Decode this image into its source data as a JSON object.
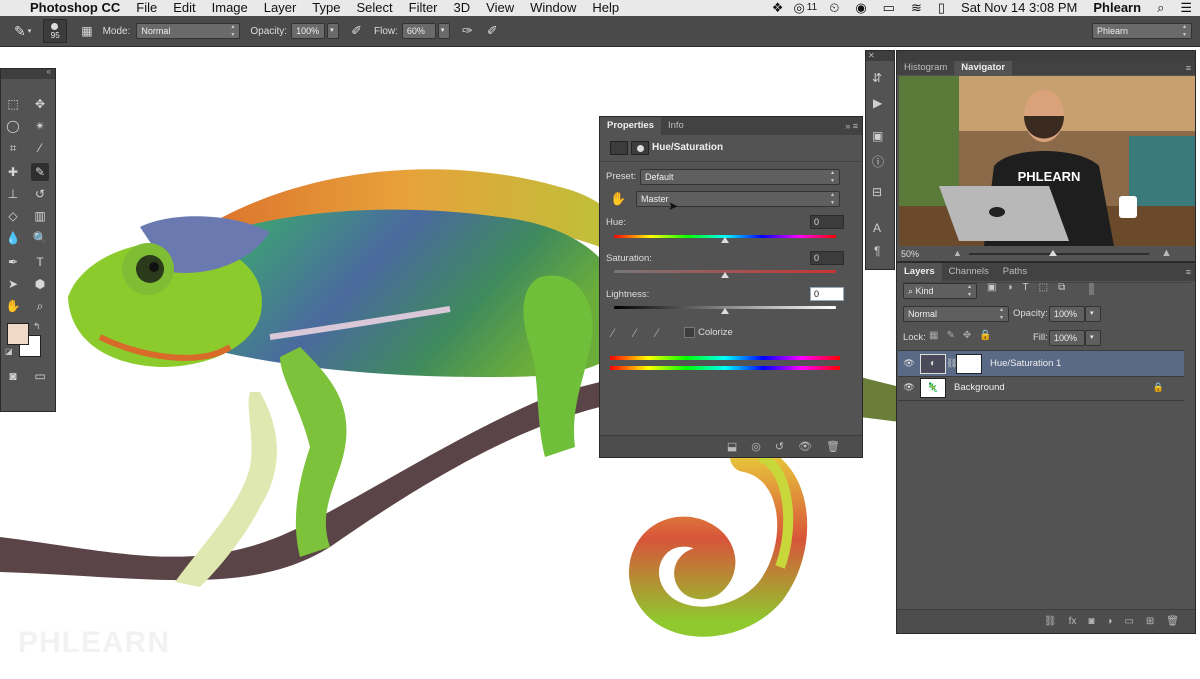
{
  "menubar": {
    "app_name": "Photoshop CC",
    "items": [
      "File",
      "Edit",
      "Image",
      "Layer",
      "Type",
      "Select",
      "Filter",
      "3D",
      "View",
      "Window",
      "Help"
    ],
    "status_number": "11",
    "datetime": "Sat Nov 14  3:08 PM",
    "user": "Phlearn"
  },
  "options": {
    "brush_size": "95",
    "mode_label": "Mode:",
    "mode_value": "Normal",
    "opacity_label": "Opacity:",
    "opacity_value": "100%",
    "flow_label": "Flow:",
    "flow_value": "60%",
    "workspace": "Phlearn"
  },
  "properties": {
    "tabs": [
      "Properties",
      "Info"
    ],
    "title": "Hue/Saturation",
    "preset_label": "Preset:",
    "preset_value": "Default",
    "channel_value": "Master",
    "hue_label": "Hue:",
    "hue_value": "0",
    "saturation_label": "Saturation:",
    "saturation_value": "0",
    "lightness_label": "Lightness:",
    "lightness_value": "0",
    "colorize_label": "Colorize",
    "colorize_checked": false
  },
  "navigator": {
    "tabs": [
      "Histogram",
      "Navigator"
    ],
    "zoom": "50%",
    "shirt_text": "PHLEARN"
  },
  "layers": {
    "tabs": [
      "Layers",
      "Channels",
      "Paths"
    ],
    "filter_value": "Kind",
    "blend_mode": "Normal",
    "opacity_label": "Opacity:",
    "opacity_value": "100%",
    "lock_label": "Lock:",
    "fill_label": "Fill:",
    "fill_value": "100%",
    "rows": [
      {
        "name": "Hue/Saturation 1",
        "selected": true
      },
      {
        "name": "Background",
        "selected": false
      }
    ]
  },
  "watermark": "PHLEARN",
  "colors": {
    "panel_bg": "#535353",
    "selected_row": "#5a6a86",
    "foreground_swatch": "#f0d9c6",
    "background_swatch": "#ffffff"
  }
}
